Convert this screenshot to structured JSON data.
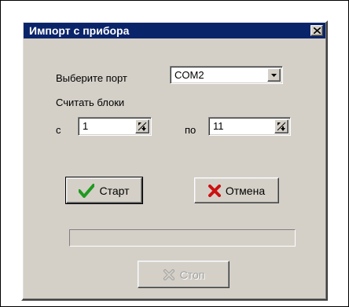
{
  "window": {
    "title": "Импорт с прибора"
  },
  "port": {
    "label": "Выберите порт",
    "selected": "COM2"
  },
  "blocks": {
    "label": "Считать блоки",
    "from_label": "с",
    "from_value": "1",
    "to_label": "по",
    "to_value": "11"
  },
  "buttons": {
    "start_label": "Старт",
    "cancel_label": "Отмена",
    "stop_label": "Стоп"
  },
  "progress": {
    "value": 0
  },
  "icons": {
    "close": "close-icon",
    "start": "checkmark-icon",
    "cancel": "x-icon",
    "stop": "stop-icon",
    "dropdown": "chevron-down-icon",
    "spinner": "spinner-icon"
  },
  "colors": {
    "titlebar": "#0a246a",
    "face": "#d4d0c8",
    "check": "#1f9a1f",
    "cancel_x": "#cc1010"
  }
}
